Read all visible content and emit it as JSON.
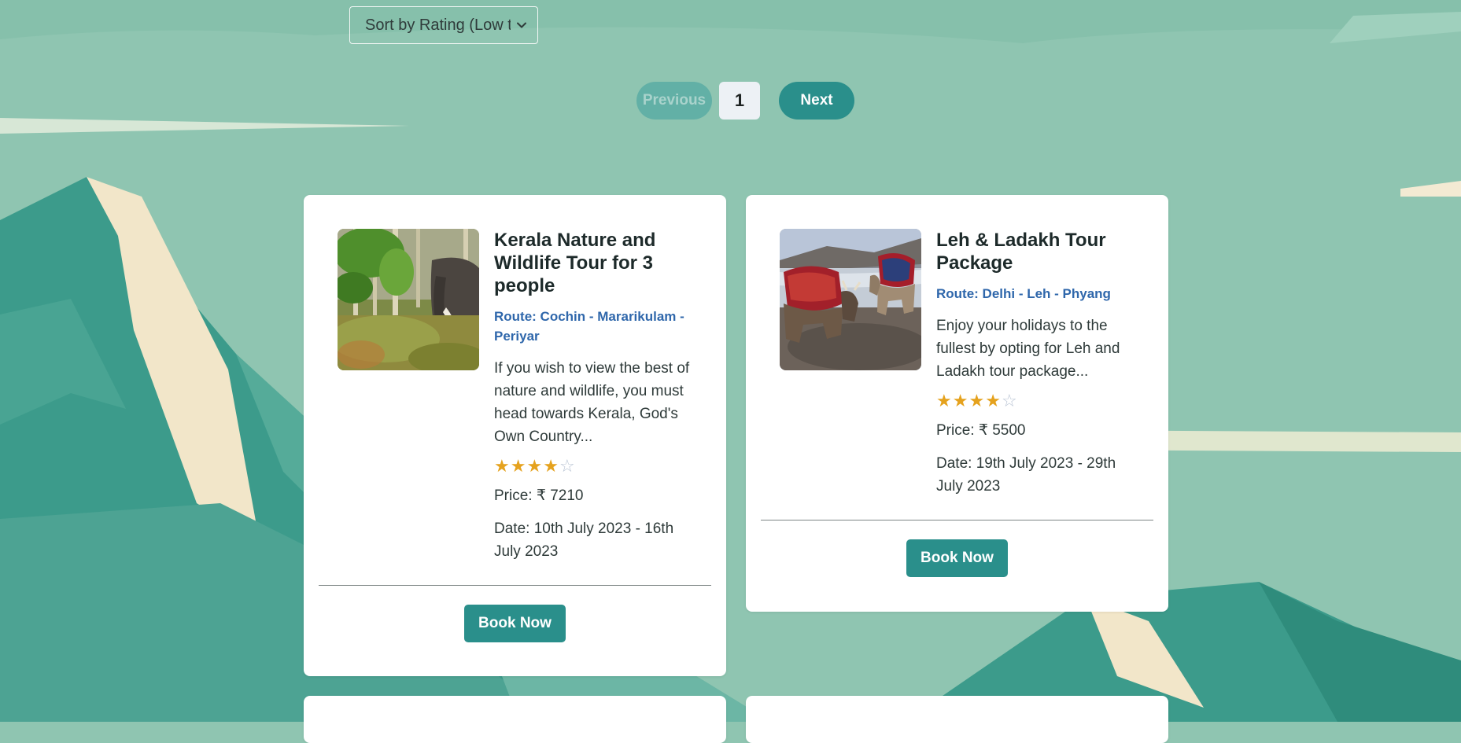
{
  "sort": {
    "label": "Sort by Rating (Low to High)"
  },
  "pagination": {
    "previous_label": "Previous",
    "current_page": "1",
    "next_label": "Next"
  },
  "tours": [
    {
      "title": "Kerala Nature and Wildlife Tour for 3 people",
      "route": "Route: Cochin - Mararikulam - Periyar",
      "description": "If you wish to view the best of nature and wildlife, you must head towards Kerala, God's Own Country...",
      "rating": 4,
      "rating_max": 5,
      "price": "Price: ₹ 7210",
      "date": "Date: 10th July 2023 - 16th July 2023",
      "book_label": "Book Now",
      "image_icon": "elephant-photo"
    },
    {
      "title": "Leh & Ladakh Tour Package",
      "route": "Route: Delhi - Leh - Phyang",
      "description": "Enjoy your holidays to the fullest by opting for Leh and Ladakh tour package...",
      "rating": 4,
      "rating_max": 5,
      "price": "Price: ₹ 5500",
      "date": "Date: 19th July 2023 - 29th July 2023",
      "book_label": "Book Now",
      "image_icon": "yak-photo"
    }
  ],
  "colors": {
    "background": "#8fc5b1",
    "accent": "#2a8f8b",
    "route_text": "#2f67ab",
    "star": "#e5a21e"
  }
}
